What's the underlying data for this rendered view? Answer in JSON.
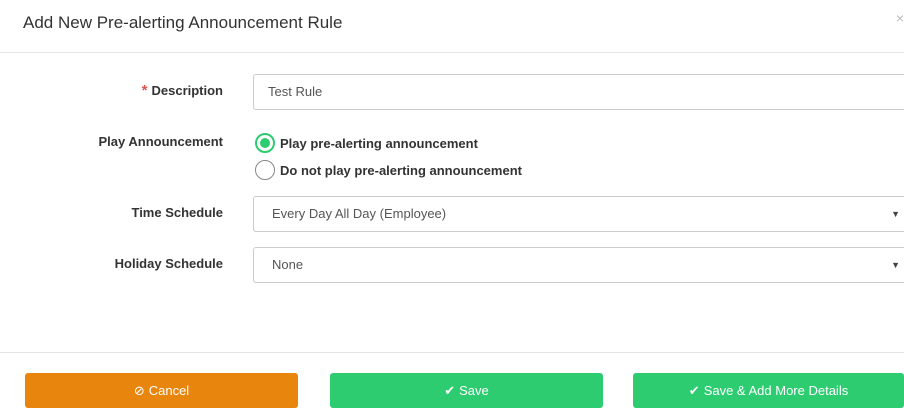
{
  "dialog": {
    "title": "Add New Pre-alerting Announcement Rule",
    "close_glyph": "×"
  },
  "form": {
    "description": {
      "required_mark": "*",
      "label": "Description",
      "value": "Test Rule"
    },
    "play_announcement": {
      "label": "Play Announcement",
      "options": [
        {
          "label": "Play pre-alerting announcement",
          "selected": true
        },
        {
          "label": "Do not play pre-alerting announcement",
          "selected": false
        }
      ]
    },
    "time_schedule": {
      "label": "Time Schedule",
      "value": "Every Day All Day (Employee)",
      "caret": "▼"
    },
    "holiday_schedule": {
      "label": "Holiday Schedule",
      "value": "None",
      "caret": "▼"
    }
  },
  "buttons": {
    "cancel": {
      "icon": "ban-icon",
      "glyph": "⊘",
      "label": "Cancel"
    },
    "save": {
      "icon": "check-icon",
      "glyph": "✔",
      "label": "Save"
    },
    "save_more": {
      "icon": "check-icon",
      "glyph": "✔",
      "label": "Save & Add More Details"
    }
  },
  "colors": {
    "cancel": "#e8850c",
    "save": "#2dcc70",
    "radio_selected": "#2ecc71",
    "required": "#d9534f"
  }
}
